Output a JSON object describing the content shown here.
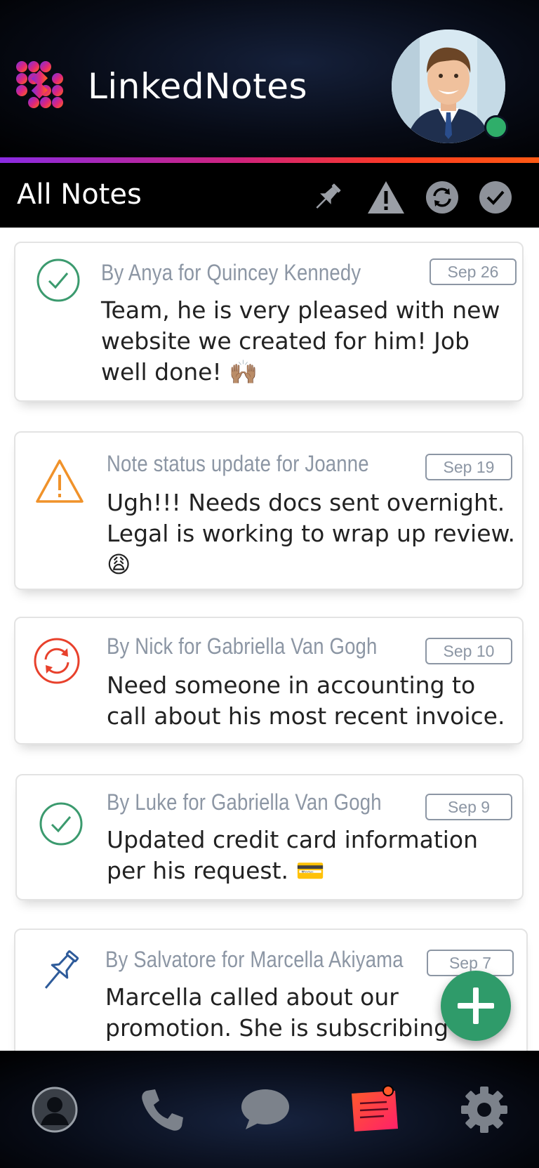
{
  "header": {
    "app_title": "LinkedNotes",
    "logo_icon": "dots-grid-logo",
    "avatar_icon": "user-avatar",
    "online_status_color": "#2fae6a"
  },
  "filter_bar": {
    "title": "All Notes",
    "filters": [
      {
        "name": "pin-filter",
        "icon": "pushpin-icon"
      },
      {
        "name": "warning-filter",
        "icon": "warning-icon"
      },
      {
        "name": "sync-filter",
        "icon": "refresh-icon"
      },
      {
        "name": "done-filter",
        "icon": "check-icon"
      }
    ]
  },
  "notes": [
    {
      "status": "done",
      "author": "By Anya for Quincey Kennedy",
      "date": "Sep 26",
      "text": "Team, he is very pleased with new website we created for him! Job well done! 🙌🏽"
    },
    {
      "status": "warning",
      "author": "Note status update for Joanne",
      "date": "Sep 19",
      "text": "Ugh!!! Needs docs sent overnight. Legal is working to wrap up review. 😩"
    },
    {
      "status": "in-progress",
      "author": "By Nick for Gabriella Van Gogh",
      "date": "Sep 10",
      "text": "Need someone in accounting to call about his most recent invoice."
    },
    {
      "status": "done",
      "author": "By Luke for Gabriella Van Gogh",
      "date": "Sep 9",
      "text": "Updated credit card information per his request. 💳"
    },
    {
      "status": "pinned",
      "author": "By Salvatore for Marcella Akiyama",
      "date": "Sep 7",
      "text": "Marcella called about our promotion. She is subscribing to"
    }
  ],
  "colors": {
    "done": "#3b9a6e",
    "warning": "#f0922a",
    "in_progress": "#e8412c",
    "pinned": "#2e5b9a",
    "fab": "#2f9b6a",
    "active_nav": "#ff2d55"
  },
  "bottom_nav": [
    {
      "name": "contacts",
      "icon": "user-icon"
    },
    {
      "name": "calls",
      "icon": "phone-icon"
    },
    {
      "name": "messages",
      "icon": "chat-icon"
    },
    {
      "name": "notes",
      "icon": "notes-icon",
      "active": true
    },
    {
      "name": "settings",
      "icon": "gear-icon"
    }
  ]
}
